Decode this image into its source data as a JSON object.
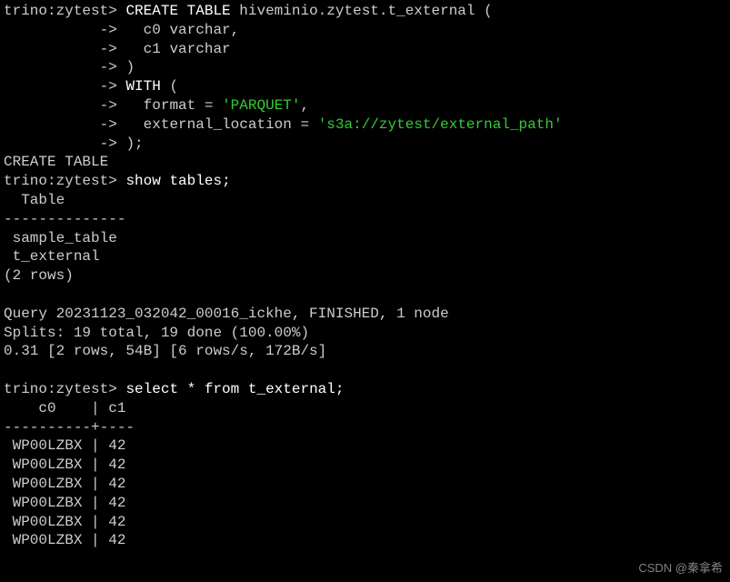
{
  "prompt": "trino:zytest>",
  "cont": "           ->",
  "sql": {
    "create_pre": "CREATE TABLE",
    "create_table_name": "hiveminio.zytest.t_external",
    "open_paren": "(",
    "col0": "c0 varchar",
    "comma": ",",
    "col1": "c1 varchar",
    "close_paren": ")",
    "with": "WITH",
    "open_paren2": "(",
    "format_key": "format",
    "equals": "=",
    "format_val": "'PARQUET'",
    "loc_key": "external_location",
    "loc_val": "'s3a://zytest/external_path'",
    "end": ")",
    "semi": ";"
  },
  "create_response": "CREATE TABLE",
  "show_tables_cmd": "show tables",
  "tables_header": "  Table",
  "tables_sep": "--------------",
  "tables": [
    " sample_table",
    " t_external"
  ],
  "rowcount": "(2 rows)",
  "query_info": {
    "line1": "Query 20231123_032042_00016_ickhe, FINISHED, 1 node",
    "line2": "Splits: 19 total, 19 done (100.00%)",
    "line3": "0.31 [2 rows, 54B] [6 rows/s, 172B/s]"
  },
  "select_cmd": "select * from t_external",
  "select_header": "    c0    | c1",
  "select_sep": "----------+----",
  "select_rows": [
    " WP00LZBX | 42",
    " WP00LZBX | 42",
    " WP00LZBX | 42",
    " WP00LZBX | 42",
    " WP00LZBX | 42",
    " WP00LZBX | 42"
  ],
  "watermark": "CSDN @秦拿希"
}
